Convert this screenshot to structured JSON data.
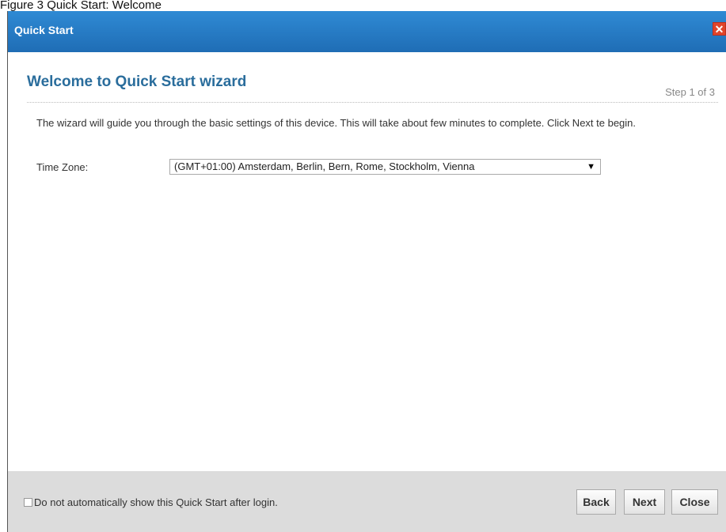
{
  "caption": "Figure 3   Quick Start: Welcome",
  "dialog": {
    "title": "Quick Start",
    "close_icon": "close-icon",
    "heading": "Welcome to Quick Start wizard",
    "step": "Step 1 of 3",
    "description": "The wizard will guide you through the basic settings of this device. This will take about few minutes to complete. Click Next te begin.",
    "time_zone_label": "Time Zone:",
    "time_zone_value": "(GMT+01:00) Amsterdam, Berlin, Bern, Rome, Stockholm, Vienna",
    "footer": {
      "checkbox_label": "Do not automatically show this Quick Start after login.",
      "checkbox_checked": false,
      "back": "Back",
      "next": "Next",
      "close": "Close"
    }
  },
  "colors": {
    "titlebar": "#1f6db5",
    "heading": "#2a6d9c",
    "close_icon": "#e0442a",
    "footer": "#dcdcdc"
  }
}
